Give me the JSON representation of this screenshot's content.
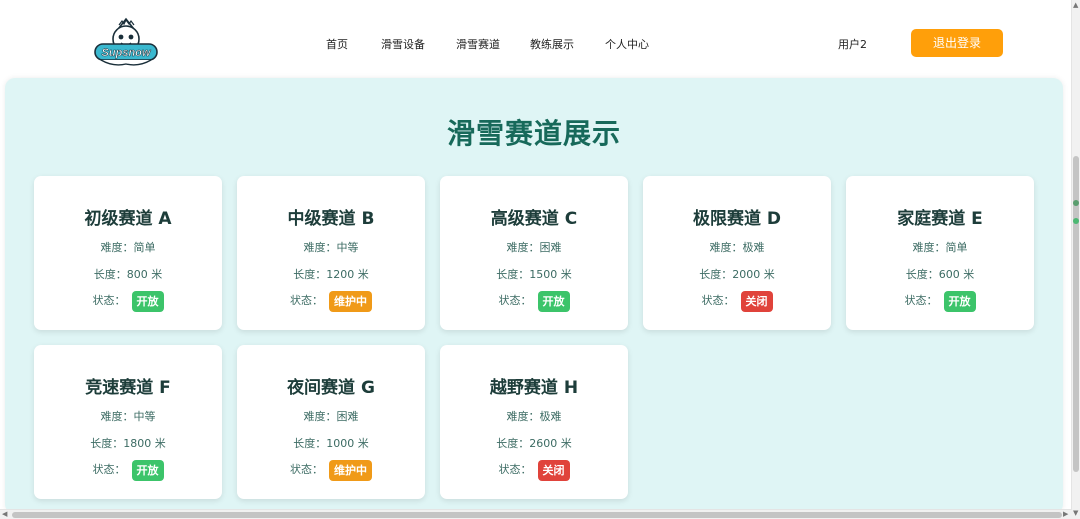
{
  "header": {
    "logo_text": "Supsnow",
    "nav": [
      {
        "label": "首页"
      },
      {
        "label": "滑雪设备"
      },
      {
        "label": "滑雪赛道"
      },
      {
        "label": "教练展示"
      },
      {
        "label": "个人中心"
      }
    ],
    "user_name": "用户2",
    "logout_label": "退出登录"
  },
  "main": {
    "title": "滑雪赛道展示",
    "difficulty_prefix": "难度：",
    "length_prefix": "长度：",
    "status_prefix": "状态：",
    "tracks": [
      {
        "name": "初级赛道 A",
        "difficulty": "简单",
        "length": "800 米",
        "status": "开放"
      },
      {
        "name": "中级赛道 B",
        "difficulty": "中等",
        "length": "1200 米",
        "status": "维护中"
      },
      {
        "name": "高级赛道 C",
        "difficulty": "困难",
        "length": "1500 米",
        "status": "开放"
      },
      {
        "name": "极限赛道 D",
        "difficulty": "极难",
        "length": "2000 米",
        "status": "关闭"
      },
      {
        "name": "家庭赛道 E",
        "difficulty": "简单",
        "length": "600 米",
        "status": "开放"
      },
      {
        "name": "竞速赛道 F",
        "difficulty": "中等",
        "length": "1800 米",
        "status": "开放"
      },
      {
        "name": "夜间赛道 G",
        "difficulty": "困难",
        "length": "1000 米",
        "status": "维护中"
      },
      {
        "name": "越野赛道 H",
        "difficulty": "极难",
        "length": "2600 米",
        "status": "关闭"
      }
    ]
  },
  "colors": {
    "accent_orange": "#ff9f0a",
    "title_green": "#17695a",
    "panel_bg": "#dff5f5",
    "status_open": "#3cc46a",
    "status_maintenance": "#f09a18",
    "status_closed": "#e0433b"
  }
}
